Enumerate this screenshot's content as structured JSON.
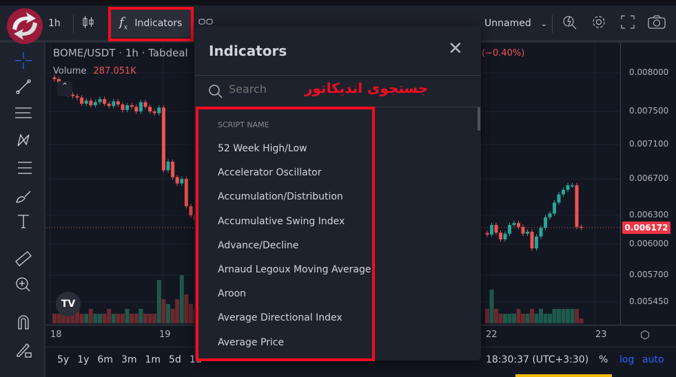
{
  "toolbar": {
    "interval": "1h",
    "indicators_label": "Indicators",
    "layout_name": "Unnamed"
  },
  "chart": {
    "title": "BOME/USDT · 1h · Tabdeal",
    "change": "(−0.40%)",
    "volume_label": "Volume",
    "volume_value": "287.051K",
    "current_price": "0.006172",
    "price_ticks": [
      "0.008000",
      "0.007500",
      "0.007100",
      "0.006700",
      "0.006300",
      "0.006000",
      "0.005700",
      "0.005450"
    ],
    "price_tick_values": [
      0.008,
      0.0075,
      0.0071,
      0.0067,
      0.0063,
      0.006,
      0.0057,
      0.00545
    ],
    "time_ticks": [
      "18",
      "19",
      "22",
      "23"
    ],
    "candles_left": [
      0.00792,
      0.00785,
      0.00778,
      0.00772,
      0.0077,
      0.00768,
      0.0076,
      0.00764,
      0.00758,
      0.00762,
      0.00766,
      0.0076,
      0.00757,
      0.00763,
      0.00759,
      0.00752,
      0.00758,
      0.00756,
      0.0075,
      0.00762,
      0.00756,
      0.0075,
      0.00748,
      0.00755,
      0.0068,
      0.0069,
      0.00672,
      0.00665,
      0.0067,
      0.0064,
      0.0063,
      0.00625
    ],
    "candles_right": [
      0.0061,
      0.0062,
      0.00612,
      0.00605,
      0.00611,
      0.0062,
      0.00622,
      0.00618,
      0.00611,
      0.00613,
      0.00596,
      0.00608,
      0.00617,
      0.00628,
      0.00632,
      0.00644,
      0.00653,
      0.00658,
      0.00663,
      0.00663,
      0.00618,
      0.00617
    ],
    "volumes_left": [
      2,
      2,
      3,
      2,
      2,
      3,
      2,
      2,
      3,
      2,
      2,
      2,
      3,
      2,
      2,
      2,
      3,
      2,
      2,
      3,
      2,
      2,
      2,
      9,
      5,
      4,
      3,
      5,
      10,
      6,
      4,
      3
    ],
    "volumes_right": [
      3,
      7,
      3,
      2,
      2,
      2,
      2,
      3,
      2,
      2,
      3,
      2,
      3,
      2,
      2,
      3,
      3,
      3,
      3,
      3,
      3,
      1
    ],
    "colors": {
      "up": "#26a69a",
      "down": "#ef5350",
      "price_badge": "#f23645"
    }
  },
  "dialog": {
    "title": "Indicators",
    "search_placeholder": "Search",
    "annotation": "جستجوی اندیکاتور",
    "column_header": "SCRIPT NAME",
    "items": [
      "52 Week High/Low",
      "Accelerator Oscillator",
      "Accumulation/Distribution",
      "Accumulative Swing Index",
      "Advance/Decline",
      "Arnaud Legoux Moving Average",
      "Aroon",
      "Average Directional Index",
      "Average Price"
    ]
  },
  "bottom": {
    "ranges": [
      "5y",
      "1y",
      "6m",
      "3m",
      "1m",
      "5d",
      "1d"
    ],
    "time": "18:30:37 (UTC+3:30)",
    "percent": "%",
    "log": "log",
    "auto": "auto"
  },
  "highlight_color": "#f20d1f"
}
